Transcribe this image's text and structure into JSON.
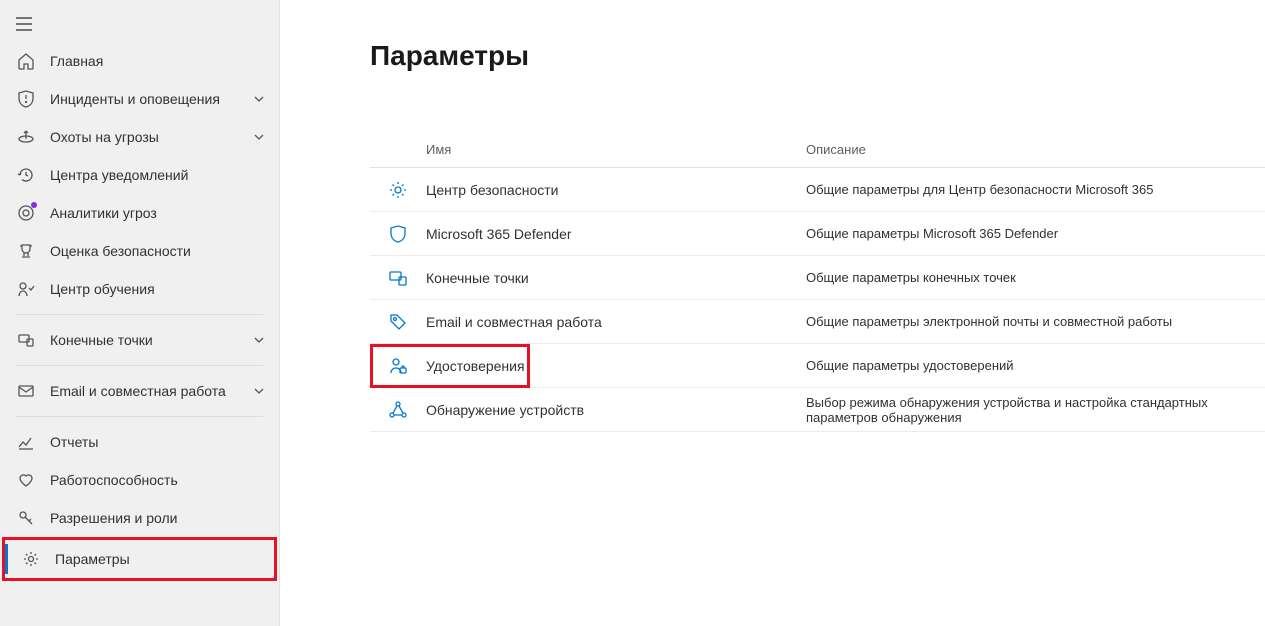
{
  "sidebar": {
    "items": [
      {
        "label": "Главная"
      },
      {
        "label": "Инциденты и оповещения"
      },
      {
        "label": "Охоты на угрозы"
      },
      {
        "label": "Центра уведомлений"
      },
      {
        "label": "Аналитики угроз"
      },
      {
        "label": "Оценка безопасности"
      },
      {
        "label": "Центр обучения"
      },
      {
        "label": "Конечные точки"
      },
      {
        "label": "Email и совместная работа"
      },
      {
        "label": "Отчеты"
      },
      {
        "label": "Работоспособность"
      },
      {
        "label": "Разрешения и роли"
      },
      {
        "label": "Параметры"
      }
    ]
  },
  "page": {
    "title": "Параметры",
    "columns": {
      "name": "Имя",
      "desc": "Описание"
    },
    "rows": [
      {
        "name": "Центр безопасности",
        "desc": "Общие параметры для Центр безопасности Microsoft 365"
      },
      {
        "name": "Microsoft 365 Defender",
        "desc": "Общие параметры Microsoft 365 Defender"
      },
      {
        "name": "Конечные точки",
        "desc": "Общие параметры конечных точек"
      },
      {
        "name": "Email и совместная работа",
        "desc": "Общие параметры электронной почты и совместной работы"
      },
      {
        "name": "Удостоверения",
        "desc": "Общие параметры удостоверений"
      },
      {
        "name": "Обнаружение устройств",
        "desc": "Выбор режима обнаружения устройства и настройка стандартных параметров обнаружения"
      }
    ]
  }
}
